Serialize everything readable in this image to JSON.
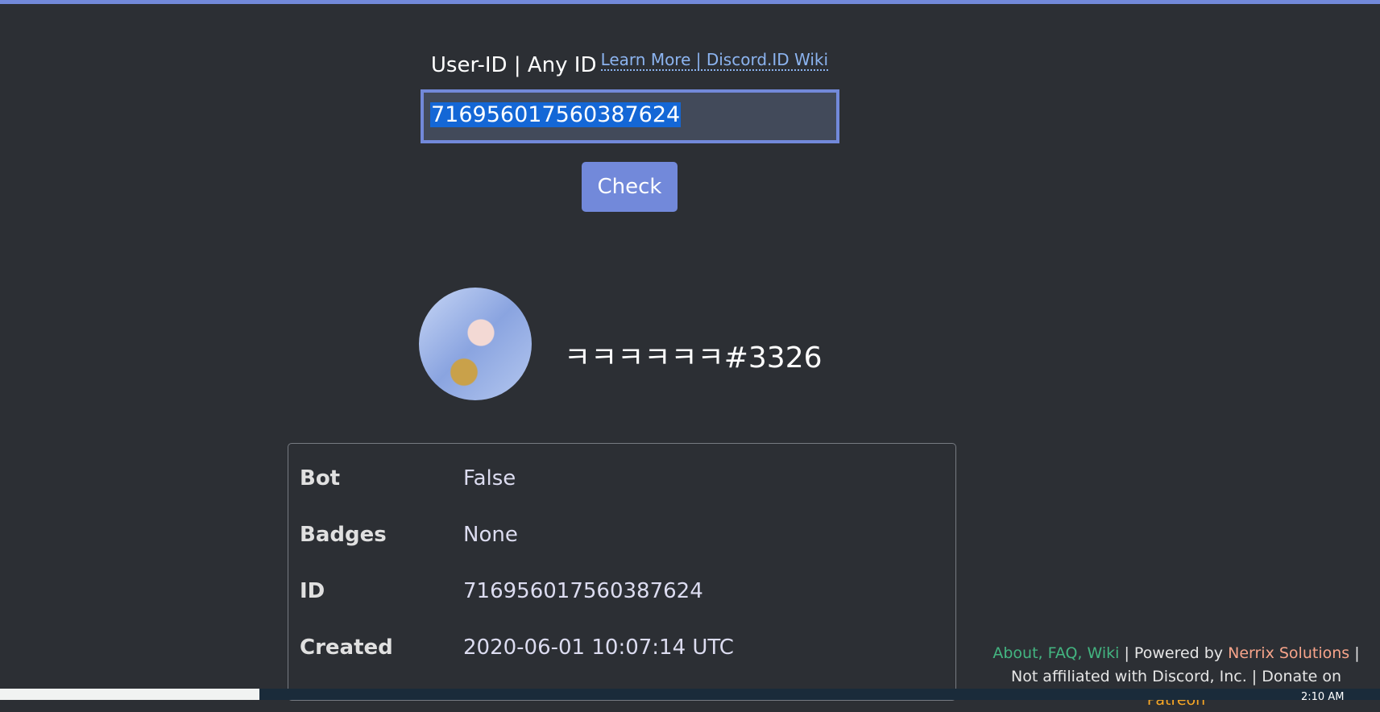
{
  "header": {
    "label": "User-ID | Any ID",
    "learn_more": "Learn More | Discord.ID Wiki"
  },
  "search": {
    "value": "716956017560387624",
    "button": "Check"
  },
  "user": {
    "name": "ㅋㅋㅋㅋㅋㅋ#3326"
  },
  "details": [
    {
      "key": "Bot",
      "value": "False"
    },
    {
      "key": "Badges",
      "value": "None"
    },
    {
      "key": "ID",
      "value": "716956017560387624"
    },
    {
      "key": "Created",
      "value": "2020-06-01 10:07:14 UTC"
    }
  ],
  "footer": {
    "about": "About, FAQ, Wiki",
    "sep1": " | Powered by ",
    "nerrix": "Nerrix Solutions",
    "sep2": " | Not affiliated with Discord, Inc. | Donate on ",
    "patreon": "Patreon"
  },
  "taskbar": {
    "clock": "2:10 AM"
  },
  "colors": {
    "accent": "#7289da",
    "about": "#43b581",
    "nerrix": "#f7a48a",
    "patreon": "#f9a825"
  }
}
